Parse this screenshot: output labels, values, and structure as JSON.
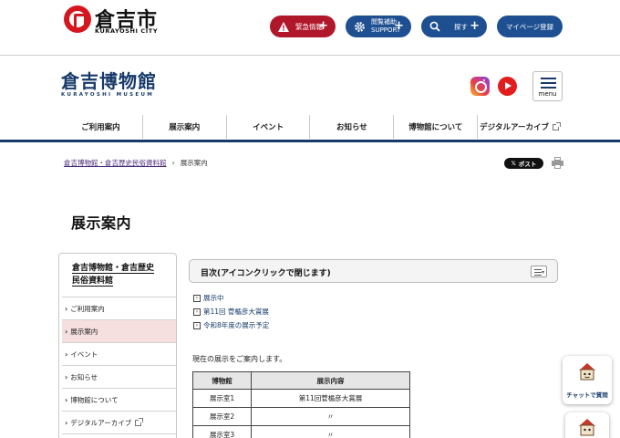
{
  "city": {
    "name": "倉吉市",
    "sub": "KURAYOSHI CITY"
  },
  "utility": {
    "emergency": "緊急情報",
    "access_line1": "閲覧補助",
    "access_line2": "SUPPORT",
    "search": "探す",
    "mypage": "マイページ登録"
  },
  "museum": {
    "name": "倉吉博物館",
    "sub": "KURAYOSHI MUSEUM"
  },
  "menu_label": "menu",
  "nav": [
    "ご利用案内",
    "展示案内",
    "イベント",
    "お知らせ",
    "博物館について",
    "デジタルアーカイブ"
  ],
  "breadcrumb": {
    "parent": "倉吉博物館・倉吉歴史民俗資料館",
    "current": "展示案内"
  },
  "x_post": "ポスト",
  "page_title": "展示案内",
  "sidebar": {
    "title_line1": "倉吉博物館・倉吉歴史",
    "title_line2": "民俗資料館",
    "items": [
      "ご利用案内",
      "展示案内",
      "イベント",
      "お知らせ",
      "博物館について",
      "デジタルアーカイブ"
    ]
  },
  "toc": {
    "title": "目次(アイコンクリックで閉じます)",
    "items": [
      "展示中",
      "第11回 菅楯彦大賞展",
      "令和8年度の展示予定"
    ]
  },
  "intro": "現在の展示をご案内します。",
  "table": {
    "headers": [
      "博物館",
      "展示内容"
    ],
    "rows": [
      [
        "展示室1",
        "第11回菅楯彦大賞展"
      ],
      [
        "展示室2",
        "〃"
      ],
      [
        "展示室3",
        "〃"
      ]
    ]
  },
  "chat_label": "チャットで質問",
  "colors": {
    "navy": "#173a6a",
    "red": "#b0172a",
    "blue": "#1d4f91",
    "active": "#f6dfdf"
  }
}
